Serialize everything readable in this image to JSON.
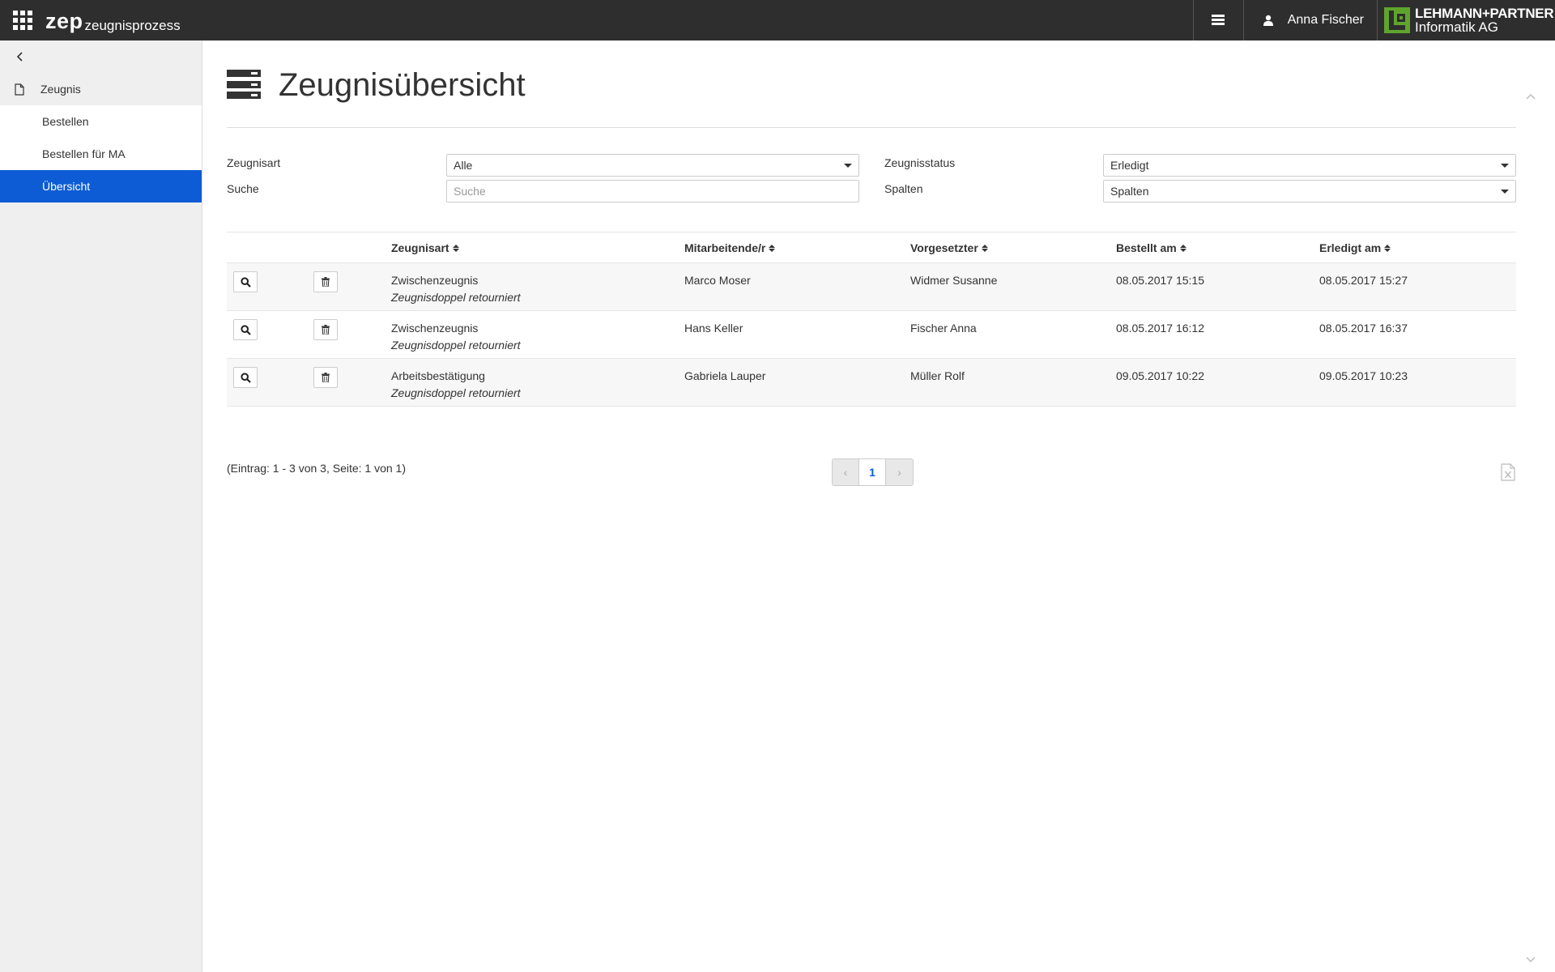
{
  "topbar": {
    "brand_main": "zep",
    "brand_sub": "zeugnisprozess",
    "user_name": "Anna Fischer",
    "logo_line1": "LEHMANN+PARTNER",
    "logo_line2": "Informatik AG"
  },
  "sidebar": {
    "section": "Zeugnis",
    "items": [
      {
        "label": "Bestellen"
      },
      {
        "label": "Bestellen für MA"
      },
      {
        "label": "Übersicht"
      }
    ]
  },
  "main": {
    "title": "Zeugnisübersicht",
    "filters": {
      "zeugnisart_label": "Zeugnisart",
      "zeugnisart_value": "Alle",
      "suche_label": "Suche",
      "suche_placeholder": "Suche",
      "status_label": "Zeugnisstatus",
      "status_value": "Erledigt",
      "spalten_label": "Spalten",
      "spalten_value": "Spalten"
    },
    "table": {
      "columns": [
        "Zeugnisart",
        "Mitarbeitende/r",
        "Vorgesetzter",
        "Bestellt am",
        "Erledigt am"
      ],
      "rows": [
        {
          "zeugnisart": "Zwischenzeugnis",
          "status": "Zeugnisdoppel retourniert",
          "mitarbeiter": "Marco Moser",
          "vorgesetzter": "Widmer Susanne",
          "bestellt": "08.05.2017 15:15",
          "erledigt": "08.05.2017 15:27"
        },
        {
          "zeugnisart": "Zwischenzeugnis",
          "status": "Zeugnisdoppel retourniert",
          "mitarbeiter": "Hans Keller",
          "vorgesetzter": "Fischer Anna",
          "bestellt": "08.05.2017 16:12",
          "erledigt": "08.05.2017 16:37"
        },
        {
          "zeugnisart": "Arbeitsbestätigung",
          "status": "Zeugnisdoppel retourniert",
          "mitarbeiter": "Gabriela Lauper",
          "vorgesetzter": "Müller Rolf",
          "bestellt": "09.05.2017 10:22",
          "erledigt": "09.05.2017 10:23"
        }
      ]
    },
    "footer": {
      "entries": "(Eintrag: 1 - 3 von 3, Seite: 1 von 1)",
      "current_page": "1",
      "prev": "‹",
      "next": "›"
    }
  },
  "colors": {
    "topbar_bg": "#2e2e2e",
    "accent": "#0d5cd6",
    "logo_green": "#5fa52d"
  }
}
